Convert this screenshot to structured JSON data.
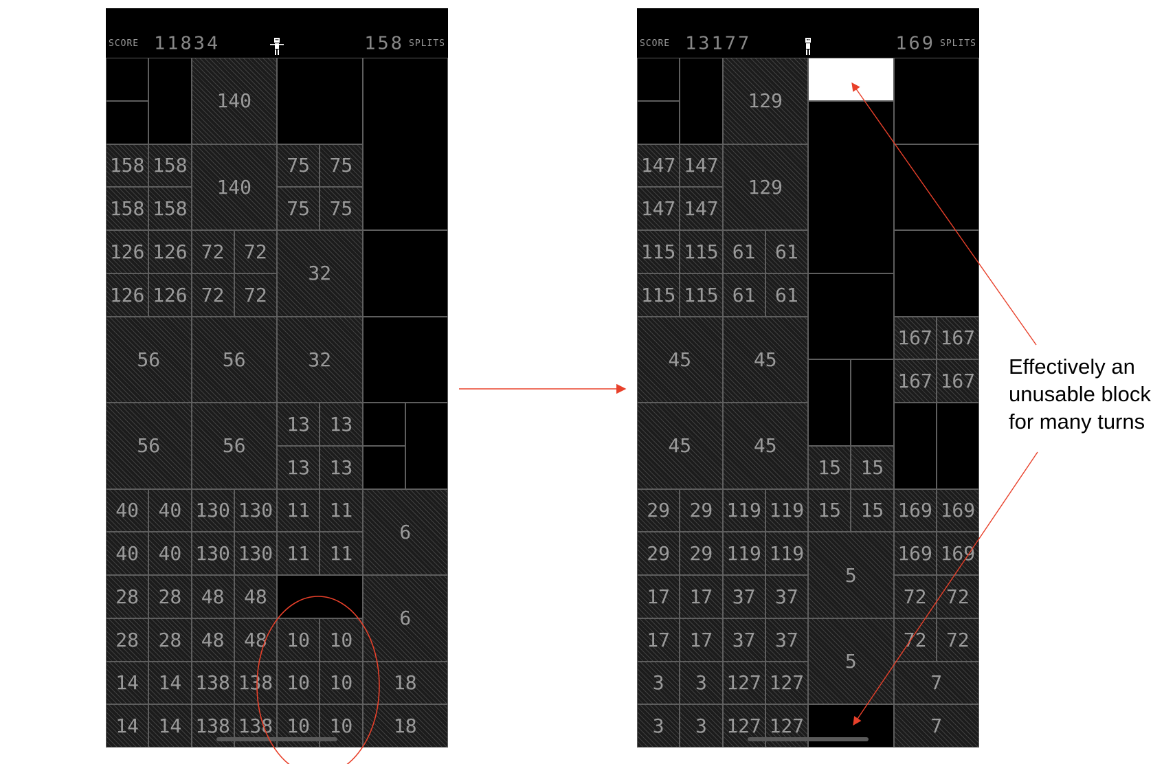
{
  "left_screen": {
    "hud": {
      "score_label": "SCORE",
      "score": "11834",
      "splits": "158",
      "splits_label": "SPLITS"
    },
    "cells": [
      {
        "c": 0,
        "r": 0,
        "w": 1,
        "h": 1,
        "t": "e",
        "v": ""
      },
      {
        "c": 0,
        "r": 1,
        "w": 1,
        "h": 1,
        "t": "e",
        "v": ""
      },
      {
        "c": 1,
        "r": 0,
        "w": 1,
        "h": 2,
        "t": "e",
        "v": ""
      },
      {
        "c": 2,
        "r": 0,
        "w": 2,
        "h": 2,
        "t": "h",
        "v": "140"
      },
      {
        "c": 4,
        "r": 0,
        "w": 2,
        "h": 2,
        "t": "e",
        "v": ""
      },
      {
        "c": 6,
        "r": 0,
        "w": 2,
        "h": 4,
        "t": "e",
        "v": ""
      },
      {
        "c": 0,
        "r": 2,
        "w": 1,
        "h": 1,
        "t": "h",
        "v": "158"
      },
      {
        "c": 1,
        "r": 2,
        "w": 1,
        "h": 1,
        "t": "h",
        "v": "158"
      },
      {
        "c": 0,
        "r": 3,
        "w": 1,
        "h": 1,
        "t": "h",
        "v": "158"
      },
      {
        "c": 1,
        "r": 3,
        "w": 1,
        "h": 1,
        "t": "h",
        "v": "158"
      },
      {
        "c": 2,
        "r": 2,
        "w": 2,
        "h": 2,
        "t": "h",
        "v": "140"
      },
      {
        "c": 4,
        "r": 2,
        "w": 1,
        "h": 1,
        "t": "h",
        "v": "75"
      },
      {
        "c": 5,
        "r": 2,
        "w": 1,
        "h": 1,
        "t": "h",
        "v": "75"
      },
      {
        "c": 4,
        "r": 3,
        "w": 1,
        "h": 1,
        "t": "h",
        "v": "75"
      },
      {
        "c": 5,
        "r": 3,
        "w": 1,
        "h": 1,
        "t": "h",
        "v": "75"
      },
      {
        "c": 0,
        "r": 4,
        "w": 1,
        "h": 1,
        "t": "h",
        "v": "126"
      },
      {
        "c": 1,
        "r": 4,
        "w": 1,
        "h": 1,
        "t": "h",
        "v": "126"
      },
      {
        "c": 2,
        "r": 4,
        "w": 1,
        "h": 1,
        "t": "h",
        "v": "72"
      },
      {
        "c": 3,
        "r": 4,
        "w": 1,
        "h": 1,
        "t": "h",
        "v": "72"
      },
      {
        "c": 0,
        "r": 5,
        "w": 1,
        "h": 1,
        "t": "h",
        "v": "126"
      },
      {
        "c": 1,
        "r": 5,
        "w": 1,
        "h": 1,
        "t": "h",
        "v": "126"
      },
      {
        "c": 2,
        "r": 5,
        "w": 1,
        "h": 1,
        "t": "h",
        "v": "72"
      },
      {
        "c": 3,
        "r": 5,
        "w": 1,
        "h": 1,
        "t": "h",
        "v": "72"
      },
      {
        "c": 4,
        "r": 4,
        "w": 2,
        "h": 2,
        "t": "h",
        "v": "32"
      },
      {
        "c": 6,
        "r": 4,
        "w": 2,
        "h": 2,
        "t": "e",
        "v": ""
      },
      {
        "c": 0,
        "r": 6,
        "w": 2,
        "h": 2,
        "t": "h",
        "v": "56"
      },
      {
        "c": 2,
        "r": 6,
        "w": 2,
        "h": 2,
        "t": "h",
        "v": "56"
      },
      {
        "c": 4,
        "r": 6,
        "w": 2,
        "h": 2,
        "t": "h",
        "v": "32"
      },
      {
        "c": 6,
        "r": 6,
        "w": 2,
        "h": 2,
        "t": "e",
        "v": ""
      },
      {
        "c": 0,
        "r": 8,
        "w": 2,
        "h": 2,
        "t": "h",
        "v": "56"
      },
      {
        "c": 2,
        "r": 8,
        "w": 2,
        "h": 2,
        "t": "h",
        "v": "56"
      },
      {
        "c": 4,
        "r": 8,
        "w": 1,
        "h": 1,
        "t": "h",
        "v": "13"
      },
      {
        "c": 5,
        "r": 8,
        "w": 1,
        "h": 1,
        "t": "h",
        "v": "13"
      },
      {
        "c": 4,
        "r": 9,
        "w": 1,
        "h": 1,
        "t": "h",
        "v": "13"
      },
      {
        "c": 5,
        "r": 9,
        "w": 1,
        "h": 1,
        "t": "h",
        "v": "13"
      },
      {
        "c": 6,
        "r": 8,
        "w": 1,
        "h": 1,
        "t": "e",
        "v": ""
      },
      {
        "c": 6,
        "r": 9,
        "w": 1,
        "h": 1,
        "t": "e",
        "v": ""
      },
      {
        "c": 7,
        "r": 8,
        "w": 1,
        "h": 2,
        "t": "e",
        "v": ""
      },
      {
        "c": 0,
        "r": 10,
        "w": 1,
        "h": 1,
        "t": "h",
        "v": "40"
      },
      {
        "c": 1,
        "r": 10,
        "w": 1,
        "h": 1,
        "t": "h",
        "v": "40"
      },
      {
        "c": 2,
        "r": 10,
        "w": 1,
        "h": 1,
        "t": "h",
        "v": "130"
      },
      {
        "c": 3,
        "r": 10,
        "w": 1,
        "h": 1,
        "t": "h",
        "v": "130"
      },
      {
        "c": 4,
        "r": 10,
        "w": 1,
        "h": 1,
        "t": "h",
        "v": "11"
      },
      {
        "c": 5,
        "r": 10,
        "w": 1,
        "h": 1,
        "t": "h",
        "v": "11"
      },
      {
        "c": 0,
        "r": 11,
        "w": 1,
        "h": 1,
        "t": "h",
        "v": "40"
      },
      {
        "c": 1,
        "r": 11,
        "w": 1,
        "h": 1,
        "t": "h",
        "v": "40"
      },
      {
        "c": 2,
        "r": 11,
        "w": 1,
        "h": 1,
        "t": "h",
        "v": "130"
      },
      {
        "c": 3,
        "r": 11,
        "w": 1,
        "h": 1,
        "t": "h",
        "v": "130"
      },
      {
        "c": 4,
        "r": 11,
        "w": 1,
        "h": 1,
        "t": "h",
        "v": "11"
      },
      {
        "c": 5,
        "r": 11,
        "w": 1,
        "h": 1,
        "t": "h",
        "v": "11"
      },
      {
        "c": 6,
        "r": 10,
        "w": 2,
        "h": 2,
        "t": "h",
        "v": "6"
      },
      {
        "c": 0,
        "r": 12,
        "w": 1,
        "h": 1,
        "t": "h",
        "v": "28"
      },
      {
        "c": 1,
        "r": 12,
        "w": 1,
        "h": 1,
        "t": "h",
        "v": "28"
      },
      {
        "c": 2,
        "r": 12,
        "w": 1,
        "h": 1,
        "t": "h",
        "v": "48"
      },
      {
        "c": 3,
        "r": 12,
        "w": 1,
        "h": 1,
        "t": "h",
        "v": "48"
      },
      {
        "c": 4,
        "r": 12,
        "w": 2,
        "h": 1,
        "t": "e",
        "v": ""
      },
      {
        "c": 0,
        "r": 13,
        "w": 1,
        "h": 1,
        "t": "h",
        "v": "28"
      },
      {
        "c": 1,
        "r": 13,
        "w": 1,
        "h": 1,
        "t": "h",
        "v": "28"
      },
      {
        "c": 2,
        "r": 13,
        "w": 1,
        "h": 1,
        "t": "h",
        "v": "48"
      },
      {
        "c": 3,
        "r": 13,
        "w": 1,
        "h": 1,
        "t": "h",
        "v": "48"
      },
      {
        "c": 4,
        "r": 13,
        "w": 1,
        "h": 1,
        "t": "h",
        "v": "10"
      },
      {
        "c": 5,
        "r": 13,
        "w": 1,
        "h": 1,
        "t": "h",
        "v": "10"
      },
      {
        "c": 6,
        "r": 12,
        "w": 2,
        "h": 2,
        "t": "h",
        "v": "6"
      },
      {
        "c": 0,
        "r": 14,
        "w": 1,
        "h": 1,
        "t": "h",
        "v": "14"
      },
      {
        "c": 1,
        "r": 14,
        "w": 1,
        "h": 1,
        "t": "h",
        "v": "14"
      },
      {
        "c": 2,
        "r": 14,
        "w": 1,
        "h": 1,
        "t": "h",
        "v": "138"
      },
      {
        "c": 3,
        "r": 14,
        "w": 1,
        "h": 1,
        "t": "h",
        "v": "138"
      },
      {
        "c": 4,
        "r": 14,
        "w": 1,
        "h": 1,
        "t": "h",
        "v": "10"
      },
      {
        "c": 5,
        "r": 14,
        "w": 1,
        "h": 1,
        "t": "h",
        "v": "10"
      },
      {
        "c": 0,
        "r": 15,
        "w": 1,
        "h": 1,
        "t": "h",
        "v": "14"
      },
      {
        "c": 1,
        "r": 15,
        "w": 1,
        "h": 1,
        "t": "h",
        "v": "14"
      },
      {
        "c": 2,
        "r": 15,
        "w": 1,
        "h": 1,
        "t": "h",
        "v": "138"
      },
      {
        "c": 3,
        "r": 15,
        "w": 1,
        "h": 1,
        "t": "h",
        "v": "138"
      },
      {
        "c": 4,
        "r": 15,
        "w": 1,
        "h": 1,
        "t": "h",
        "v": "10"
      },
      {
        "c": 5,
        "r": 15,
        "w": 1,
        "h": 1,
        "t": "h",
        "v": "10"
      },
      {
        "c": 6,
        "r": 14,
        "w": 2,
        "h": 1,
        "t": "h",
        "v": "18"
      },
      {
        "c": 6,
        "r": 15,
        "w": 2,
        "h": 1,
        "t": "h",
        "v": "18"
      }
    ]
  },
  "right_screen": {
    "hud": {
      "score_label": "SCORE",
      "score": "13177",
      "splits": "169",
      "splits_label": "SPLITS"
    },
    "cells": [
      {
        "c": 0,
        "r": 0,
        "w": 1,
        "h": 1,
        "t": "e",
        "v": ""
      },
      {
        "c": 0,
        "r": 1,
        "w": 1,
        "h": 1,
        "t": "e",
        "v": ""
      },
      {
        "c": 1,
        "r": 0,
        "w": 1,
        "h": 2,
        "t": "e",
        "v": ""
      },
      {
        "c": 2,
        "r": 0,
        "w": 2,
        "h": 2,
        "t": "h",
        "v": "129"
      },
      {
        "c": 4,
        "r": 0,
        "w": 2,
        "h": 1,
        "t": "w",
        "v": ""
      },
      {
        "c": 4,
        "r": 1,
        "w": 2,
        "h": 4,
        "t": "e",
        "v": ""
      },
      {
        "c": 4,
        "r": 5,
        "w": 2,
        "h": 2,
        "t": "e",
        "v": ""
      },
      {
        "c": 4,
        "r": 7,
        "w": 1,
        "h": 2,
        "t": "e",
        "v": ""
      },
      {
        "c": 5,
        "r": 7,
        "w": 1,
        "h": 2,
        "t": "e",
        "v": ""
      },
      {
        "c": 6,
        "r": 0,
        "w": 2,
        "h": 2,
        "t": "e",
        "v": ""
      },
      {
        "c": 6,
        "r": 2,
        "w": 2,
        "h": 2,
        "t": "e",
        "v": ""
      },
      {
        "c": 6,
        "r": 4,
        "w": 2,
        "h": 2,
        "t": "e",
        "v": ""
      },
      {
        "c": 0,
        "r": 2,
        "w": 1,
        "h": 1,
        "t": "h",
        "v": "147"
      },
      {
        "c": 1,
        "r": 2,
        "w": 1,
        "h": 1,
        "t": "h",
        "v": "147"
      },
      {
        "c": 0,
        "r": 3,
        "w": 1,
        "h": 1,
        "t": "h",
        "v": "147"
      },
      {
        "c": 1,
        "r": 3,
        "w": 1,
        "h": 1,
        "t": "h",
        "v": "147"
      },
      {
        "c": 2,
        "r": 2,
        "w": 2,
        "h": 2,
        "t": "h",
        "v": "129"
      },
      {
        "c": 0,
        "r": 4,
        "w": 1,
        "h": 1,
        "t": "h",
        "v": "115"
      },
      {
        "c": 1,
        "r": 4,
        "w": 1,
        "h": 1,
        "t": "h",
        "v": "115"
      },
      {
        "c": 2,
        "r": 4,
        "w": 1,
        "h": 1,
        "t": "h",
        "v": "61"
      },
      {
        "c": 3,
        "r": 4,
        "w": 1,
        "h": 1,
        "t": "h",
        "v": "61"
      },
      {
        "c": 0,
        "r": 5,
        "w": 1,
        "h": 1,
        "t": "h",
        "v": "115"
      },
      {
        "c": 1,
        "r": 5,
        "w": 1,
        "h": 1,
        "t": "h",
        "v": "115"
      },
      {
        "c": 2,
        "r": 5,
        "w": 1,
        "h": 1,
        "t": "h",
        "v": "61"
      },
      {
        "c": 3,
        "r": 5,
        "w": 1,
        "h": 1,
        "t": "h",
        "v": "61"
      },
      {
        "c": 0,
        "r": 6,
        "w": 2,
        "h": 2,
        "t": "h",
        "v": "45"
      },
      {
        "c": 2,
        "r": 6,
        "w": 2,
        "h": 2,
        "t": "h",
        "v": "45"
      },
      {
        "c": 6,
        "r": 6,
        "w": 1,
        "h": 1,
        "t": "h",
        "v": "167"
      },
      {
        "c": 7,
        "r": 6,
        "w": 1,
        "h": 1,
        "t": "h",
        "v": "167"
      },
      {
        "c": 6,
        "r": 7,
        "w": 1,
        "h": 1,
        "t": "h",
        "v": "167"
      },
      {
        "c": 7,
        "r": 7,
        "w": 1,
        "h": 1,
        "t": "h",
        "v": "167"
      },
      {
        "c": 0,
        "r": 8,
        "w": 2,
        "h": 2,
        "t": "h",
        "v": "45"
      },
      {
        "c": 2,
        "r": 8,
        "w": 2,
        "h": 2,
        "t": "h",
        "v": "45"
      },
      {
        "c": 4,
        "r": 9,
        "w": 1,
        "h": 1,
        "t": "h",
        "v": "15"
      },
      {
        "c": 5,
        "r": 9,
        "w": 1,
        "h": 1,
        "t": "h",
        "v": "15"
      },
      {
        "c": 6,
        "r": 8,
        "w": 1,
        "h": 2,
        "t": "e",
        "v": ""
      },
      {
        "c": 7,
        "r": 8,
        "w": 1,
        "h": 2,
        "t": "e",
        "v": ""
      },
      {
        "c": 0,
        "r": 10,
        "w": 1,
        "h": 1,
        "t": "h",
        "v": "29"
      },
      {
        "c": 1,
        "r": 10,
        "w": 1,
        "h": 1,
        "t": "h",
        "v": "29"
      },
      {
        "c": 2,
        "r": 10,
        "w": 1,
        "h": 1,
        "t": "h",
        "v": "119"
      },
      {
        "c": 3,
        "r": 10,
        "w": 1,
        "h": 1,
        "t": "h",
        "v": "119"
      },
      {
        "c": 4,
        "r": 10,
        "w": 1,
        "h": 1,
        "t": "h",
        "v": "15"
      },
      {
        "c": 5,
        "r": 10,
        "w": 1,
        "h": 1,
        "t": "h",
        "v": "15"
      },
      {
        "c": 6,
        "r": 10,
        "w": 1,
        "h": 1,
        "t": "h",
        "v": "169"
      },
      {
        "c": 7,
        "r": 10,
        "w": 1,
        "h": 1,
        "t": "h",
        "v": "169"
      },
      {
        "c": 0,
        "r": 11,
        "w": 1,
        "h": 1,
        "t": "h",
        "v": "29"
      },
      {
        "c": 1,
        "r": 11,
        "w": 1,
        "h": 1,
        "t": "h",
        "v": "29"
      },
      {
        "c": 2,
        "r": 11,
        "w": 1,
        "h": 1,
        "t": "h",
        "v": "119"
      },
      {
        "c": 3,
        "r": 11,
        "w": 1,
        "h": 1,
        "t": "h",
        "v": "119"
      },
      {
        "c": 6,
        "r": 11,
        "w": 1,
        "h": 1,
        "t": "h",
        "v": "169"
      },
      {
        "c": 7,
        "r": 11,
        "w": 1,
        "h": 1,
        "t": "h",
        "v": "169"
      },
      {
        "c": 4,
        "r": 11,
        "w": 2,
        "h": 2,
        "t": "h",
        "v": "5"
      },
      {
        "c": 0,
        "r": 12,
        "w": 1,
        "h": 1,
        "t": "h",
        "v": "17"
      },
      {
        "c": 1,
        "r": 12,
        "w": 1,
        "h": 1,
        "t": "h",
        "v": "17"
      },
      {
        "c": 2,
        "r": 12,
        "w": 1,
        "h": 1,
        "t": "h",
        "v": "37"
      },
      {
        "c": 3,
        "r": 12,
        "w": 1,
        "h": 1,
        "t": "h",
        "v": "37"
      },
      {
        "c": 6,
        "r": 12,
        "w": 1,
        "h": 1,
        "t": "h",
        "v": "72"
      },
      {
        "c": 7,
        "r": 12,
        "w": 1,
        "h": 1,
        "t": "h",
        "v": "72"
      },
      {
        "c": 0,
        "r": 13,
        "w": 1,
        "h": 1,
        "t": "h",
        "v": "17"
      },
      {
        "c": 1,
        "r": 13,
        "w": 1,
        "h": 1,
        "t": "h",
        "v": "17"
      },
      {
        "c": 2,
        "r": 13,
        "w": 1,
        "h": 1,
        "t": "h",
        "v": "37"
      },
      {
        "c": 3,
        "r": 13,
        "w": 1,
        "h": 1,
        "t": "h",
        "v": "37"
      },
      {
        "c": 6,
        "r": 13,
        "w": 1,
        "h": 1,
        "t": "h",
        "v": "72"
      },
      {
        "c": 7,
        "r": 13,
        "w": 1,
        "h": 1,
        "t": "h",
        "v": "72"
      },
      {
        "c": 4,
        "r": 13,
        "w": 2,
        "h": 2,
        "t": "h",
        "v": "5"
      },
      {
        "c": 0,
        "r": 14,
        "w": 1,
        "h": 1,
        "t": "h",
        "v": "3"
      },
      {
        "c": 1,
        "r": 14,
        "w": 1,
        "h": 1,
        "t": "h",
        "v": "3"
      },
      {
        "c": 2,
        "r": 14,
        "w": 1,
        "h": 1,
        "t": "h",
        "v": "127"
      },
      {
        "c": 3,
        "r": 14,
        "w": 1,
        "h": 1,
        "t": "h",
        "v": "127"
      },
      {
        "c": 6,
        "r": 14,
        "w": 2,
        "h": 1,
        "t": "h",
        "v": "7"
      },
      {
        "c": 0,
        "r": 15,
        "w": 1,
        "h": 1,
        "t": "h",
        "v": "3"
      },
      {
        "c": 1,
        "r": 15,
        "w": 1,
        "h": 1,
        "t": "h",
        "v": "3"
      },
      {
        "c": 2,
        "r": 15,
        "w": 1,
        "h": 1,
        "t": "h",
        "v": "127"
      },
      {
        "c": 3,
        "r": 15,
        "w": 1,
        "h": 1,
        "t": "h",
        "v": "127"
      },
      {
        "c": 4,
        "r": 15,
        "w": 2,
        "h": 1,
        "t": "e",
        "v": ""
      },
      {
        "c": 6,
        "r": 15,
        "w": 2,
        "h": 1,
        "t": "h",
        "v": "7"
      }
    ]
  },
  "annotation": {
    "lines": [
      "Effectively an",
      "unusable block",
      "for many turns"
    ],
    "color": "#e8402a"
  }
}
